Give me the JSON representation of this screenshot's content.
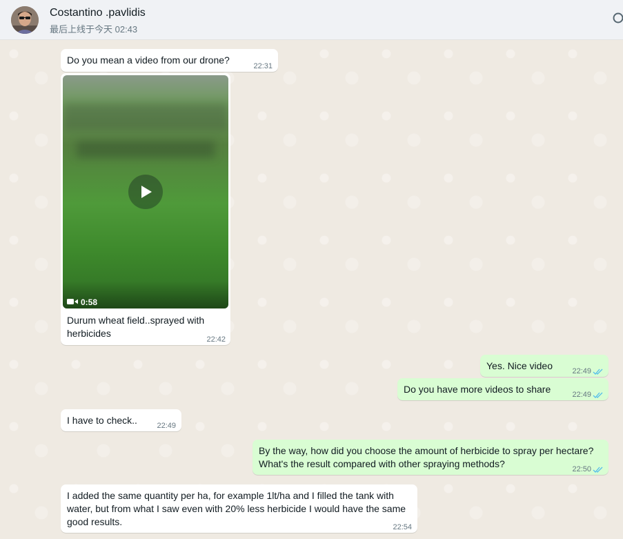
{
  "header": {
    "contact_name": "Costantino .pavlidis",
    "last_seen": "最后上线于今天 02:43"
  },
  "messages": [
    {
      "direction": "incoming",
      "text": "Do you mean a video from our drone?",
      "time": "22:31"
    },
    {
      "direction": "incoming",
      "type": "video",
      "duration": "0:58",
      "caption_lines": [
        "Durum wheat field..sprayed with",
        "herbicides"
      ],
      "time": "22:42"
    },
    {
      "direction": "outgoing",
      "text": "Yes. Nice video",
      "time": "22:49",
      "status": "read"
    },
    {
      "direction": "outgoing",
      "text": "Do you have more videos to share",
      "time": "22:49",
      "status": "read"
    },
    {
      "direction": "incoming",
      "text": "I have to check..",
      "time": "22:49"
    },
    {
      "direction": "outgoing",
      "lines": [
        "By the way, how did you choose the amount of herbicide to spray per hectare?",
        "What's the result compared with other spraying methods?"
      ],
      "time": "22:50",
      "status": "read"
    },
    {
      "direction": "incoming",
      "lines": [
        "I added the same quantity per ha,  for example 1lt/ha and I filled the tank with",
        "water, but from what I saw even with 20% less herbicide I would have the same",
        "good results."
      ],
      "time": "22:54"
    }
  ],
  "colors": {
    "incoming_bubble": "#ffffff",
    "outgoing_bubble": "#d9fdd3",
    "read_ticks": "#53bdeb",
    "chat_background": "#efeae2"
  },
  "icons": [
    "avatar",
    "search-icon",
    "play-icon",
    "video-camera-icon",
    "double-check-icon"
  ]
}
